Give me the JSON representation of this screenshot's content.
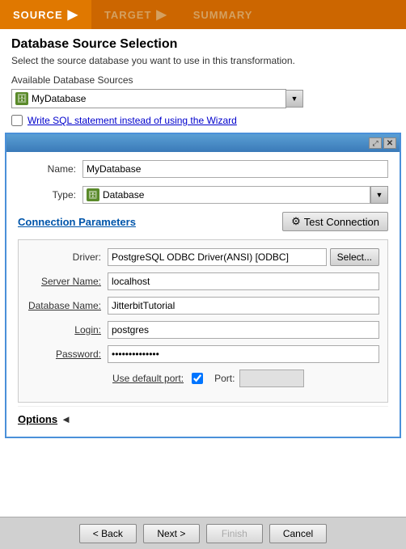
{
  "nav": {
    "source": "SOURCE",
    "target": "TARGET",
    "summary": "SUMMARY"
  },
  "page": {
    "title": "Database Source Selection",
    "subtitle": "Select the source database you want to use in this transformation.",
    "available_sources_label": "Available Database Sources",
    "db_source_name": "MyDatabase",
    "checkbox_label": "Write SQL statement instead of using the Wizard"
  },
  "inner_panel": {
    "name_label": "Name:",
    "name_value": "MyDatabase",
    "type_label": "Type:",
    "type_value": "Database",
    "connection_params_title": "Connection Parameters",
    "test_connection_label": "Test Connection",
    "driver_label": "Driver:",
    "driver_value": "PostgreSQL ODBC Driver(ANSI) [ODBC]",
    "select_label": "Select...",
    "server_name_label": "Server Name:",
    "server_name_value": "localhost",
    "database_name_label": "Database Name:",
    "database_name_value": "JitterbitTutorial",
    "login_label": "Login:",
    "login_value": "postgres",
    "password_label": "Password:",
    "password_value": "••••••••••••••",
    "default_port_label": "Use default port:",
    "port_label": "Port:",
    "port_value": "",
    "options_label": "Options"
  },
  "buttons": {
    "back": "< Back",
    "next": "Next >",
    "finish": "Finish",
    "cancel": "Cancel"
  },
  "icons": {
    "db_icon": "🗄",
    "arrow_right": "▶",
    "arrow_left": "◄",
    "dropdown": "▼",
    "close": "✕",
    "resize": "⤢",
    "test_icon": "⚙"
  }
}
